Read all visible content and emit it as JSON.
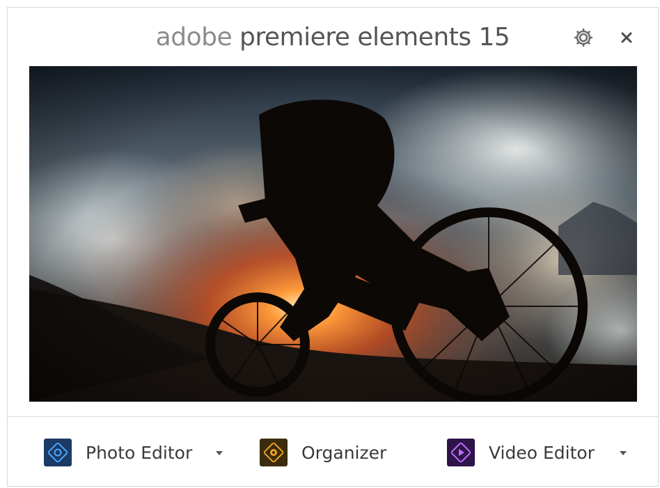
{
  "window": {
    "title_prefix": "adobe",
    "title_rest": " premiere elements 15"
  },
  "toolbar": {
    "settings_icon": "gear-icon",
    "close_icon": "close-icon"
  },
  "hero": {
    "image": "mountain-biker-silhouette-sunset"
  },
  "launchers": [
    {
      "label": "Photo Editor",
      "icon": "photo-editor-icon",
      "icon_color": "#1a3a6a",
      "has_dropdown": true
    },
    {
      "label": "Organizer",
      "icon": "organizer-icon",
      "icon_color": "#6b4a10",
      "has_dropdown": false
    },
    {
      "label": "Video Editor",
      "icon": "video-editor-icon",
      "icon_color": "#4a1a6a",
      "has_dropdown": true
    }
  ]
}
